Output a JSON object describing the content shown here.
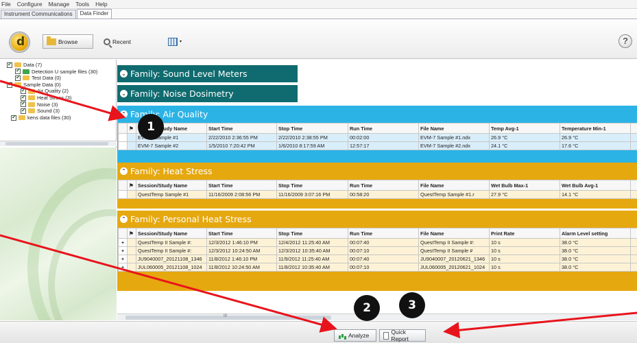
{
  "menu": [
    "File",
    "Configure",
    "Manage",
    "Tools",
    "Help"
  ],
  "tabs": [
    {
      "label": "Instrument Communications",
      "active": false
    },
    {
      "label": "Data Finder",
      "active": true
    }
  ],
  "toolbar": {
    "browse": "Browse",
    "recent": "Recent"
  },
  "tree": [
    {
      "label": "Data (7)",
      "level": 0
    },
    {
      "label": "Detection U sample files (30)",
      "level": 1
    },
    {
      "label": "Test Data (0)",
      "level": 1
    },
    {
      "label": "Sample Data (0)",
      "level": 1
    },
    {
      "label": "Air Quality (2)",
      "level": 2
    },
    {
      "label": "Heat Stress (3)",
      "level": 2
    },
    {
      "label": "Noise (3)",
      "level": 2
    },
    {
      "label": "Sound (3)",
      "level": 2
    },
    {
      "label": "kens data files (30)",
      "level": 1
    }
  ],
  "families": {
    "sound": "Family: Sound Level Meters",
    "noise": "Family: Noise Dosimetry",
    "air": "Family: Air Quality",
    "heat": "Family: Heat Stress",
    "personal": "Family: Personal Heat Stress"
  },
  "air_table": {
    "headers": [
      "Session/Study Name",
      "Start Time",
      "Stop Time",
      "Run Time",
      "File Name",
      "Temp Avg-1",
      "Temperature Min-1"
    ],
    "rows": [
      [
        "EVM-7 Sample #1",
        "2/22/2010 2:36:55 PM",
        "2/22/2010 2:38:55 PM",
        "00:02:00",
        "EVM-7 Sample #1.ndx",
        "26.9 °C",
        "26.9 °C"
      ],
      [
        "EVM-7 Sample #2",
        "1/5/2010 7:20:42 PM",
        "1/6/2010 8:17:59 AM",
        "12:57:17",
        "EVM-7 Sample #2.ndx",
        "24.1 °C",
        "17.6 °C"
      ]
    ]
  },
  "heat_table": {
    "headers": [
      "Session/Study Name",
      "Start Time",
      "Stop Time",
      "Run Time",
      "File Name",
      "Wet Bulb Max-1",
      "Wet Bulb Avg-1"
    ],
    "rows": [
      [
        "QuestTemp Sample #1",
        "11/16/2009 2:08:56 PM",
        "11/16/2009 3:07:16 PM",
        "00:58:20",
        "QuestTemp Sample #1.r",
        "27.9 °C",
        "14.1 °C"
      ]
    ]
  },
  "personal_table": {
    "headers": [
      "Session/Study Name",
      "Start Time",
      "Stop Time",
      "Run Time",
      "File Name",
      "Print Rate",
      "Alarm Level setting"
    ],
    "rows": [
      [
        "QuestTemp II Sample #:",
        "12/3/2012 1:46:10 PM",
        "12/4/2012 11:25:40 AM",
        "00:07:40",
        "QuestTemp II Sample #:",
        "10 s",
        "38.0 °C"
      ],
      [
        "QuestTemp II Sample #:",
        "12/3/2012 10:24:50 AM",
        "12/3/2012 10:35:40 AM",
        "00:07:10",
        "QuestTemp II Sample #",
        "10 s",
        "38.0 °C"
      ],
      [
        "JU9040007_20121108_1346",
        "11/8/2012 1:46:10 PM",
        "11/9/2012 11:25:40 AM",
        "00:07:40",
        "JU9040007_20120621_1346",
        "10 s",
        "38.0 °C"
      ],
      [
        "JUL060005_20121108_1024",
        "11/8/2012 10:24:50 AM",
        "11/8/2012 10:35:40 AM",
        "00:07:10",
        "JUL060005_20120621_1024",
        "10 s",
        "38.0 °C"
      ]
    ]
  },
  "expand_symbol": "+",
  "buttons": {
    "analyze": "Analyze",
    "quick_report": "Quick Report"
  },
  "callouts": [
    "1",
    "2",
    "3"
  ],
  "help_symbol": "?",
  "scroll_thumb": "III",
  "colors": {
    "teal": "#0f6b6f",
    "blue": "#2cb3e6",
    "gold": "#e6a80f",
    "arrow": "#e8141c"
  }
}
